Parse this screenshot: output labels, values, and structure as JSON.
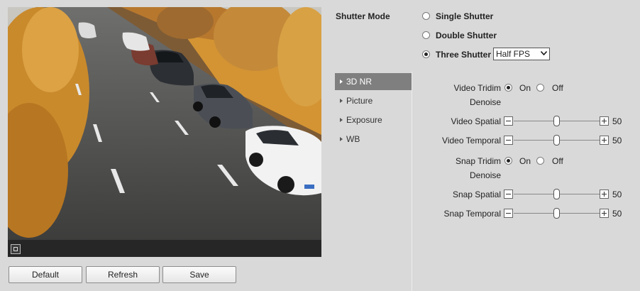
{
  "preview": {
    "osd_title": "",
    "osd_time": "",
    "osd_channel": "",
    "fullscreen_icon": "fullscreen-icon"
  },
  "buttons": {
    "default": "Default",
    "refresh": "Refresh",
    "save": "Save"
  },
  "shutter": {
    "label": "Shutter Mode",
    "options": [
      "Single Shutter",
      "Double Shutter",
      "Three Shutter"
    ],
    "selected": "Three Shutter",
    "fps_value": "Half FPS"
  },
  "menu": {
    "items": [
      "3D NR",
      "Picture",
      "Exposure",
      "WB"
    ],
    "active": "3D NR"
  },
  "settings": {
    "video_tridim_label": "Video Tridim",
    "video_tridim_label2": "Denoise",
    "snap_tridim_label": "Snap Tridim",
    "snap_tridim_label2": "Denoise",
    "on": "On",
    "off": "Off",
    "video_tridim_selected": "On",
    "snap_tridim_selected": "On",
    "sliders": [
      {
        "label": "Video Spatial",
        "value": "50",
        "fraction": 0.5
      },
      {
        "label": "Video Temporal",
        "value": "50",
        "fraction": 0.5
      },
      {
        "label": "Snap Spatial",
        "value": "50",
        "fraction": 0.5
      },
      {
        "label": "Snap Temporal",
        "value": "50",
        "fraction": 0.5
      }
    ]
  },
  "colors": {
    "background": "#d9d9d9",
    "menu_active": "#7f7f7f"
  }
}
